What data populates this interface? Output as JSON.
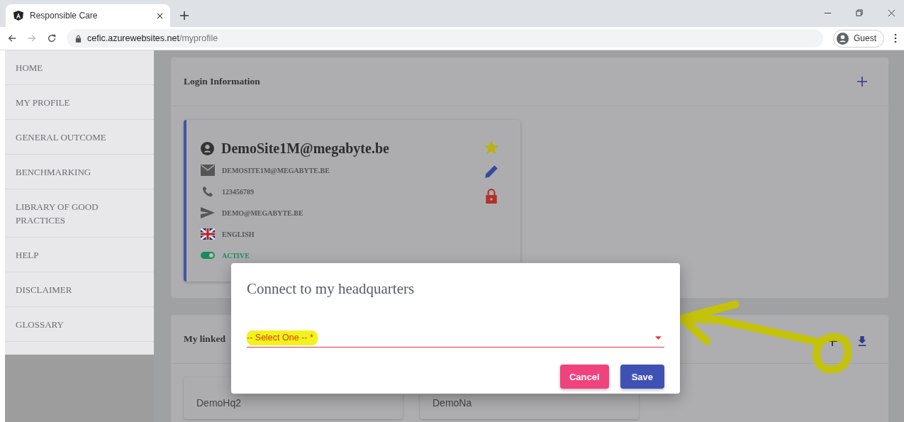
{
  "browser": {
    "tab_title": "Responsible Care",
    "url_host": "cefic.azurewebsites.net",
    "url_path": "/myprofile",
    "profile_label": "Guest"
  },
  "sidebar": {
    "items": [
      {
        "label": "HOME"
      },
      {
        "label": "MY PROFILE"
      },
      {
        "label": "GENERAL OUTCOME"
      },
      {
        "label": "BENCHMARKING"
      },
      {
        "label": "LIBRARY OF GOOD PRACTICES"
      },
      {
        "label": "HELP"
      },
      {
        "label": "DISCLAIMER"
      },
      {
        "label": "GLOSSARY"
      }
    ]
  },
  "login_panel": {
    "title": "Login Information",
    "card": {
      "name": "DemoSite1M@megabyte.be",
      "email": "DEMOSITE1M@MEGABYTE.BE",
      "phone": "123456789",
      "contact_email": "DEMO@MEGABYTE.BE",
      "language": "ENGLISH",
      "status": "ACTIVE",
      "active": true
    }
  },
  "linked_panel": {
    "title": "My linked",
    "cards": [
      "DemoHq2",
      "DemoNa"
    ]
  },
  "dialog": {
    "title": "Connect to my headquarters",
    "select": {
      "placeholder": "-- Select One -- *",
      "invalid": true
    },
    "buttons": [
      {
        "label": "Cancel",
        "kind": "cancel"
      },
      {
        "label": "Save",
        "kind": "save"
      }
    ]
  }
}
